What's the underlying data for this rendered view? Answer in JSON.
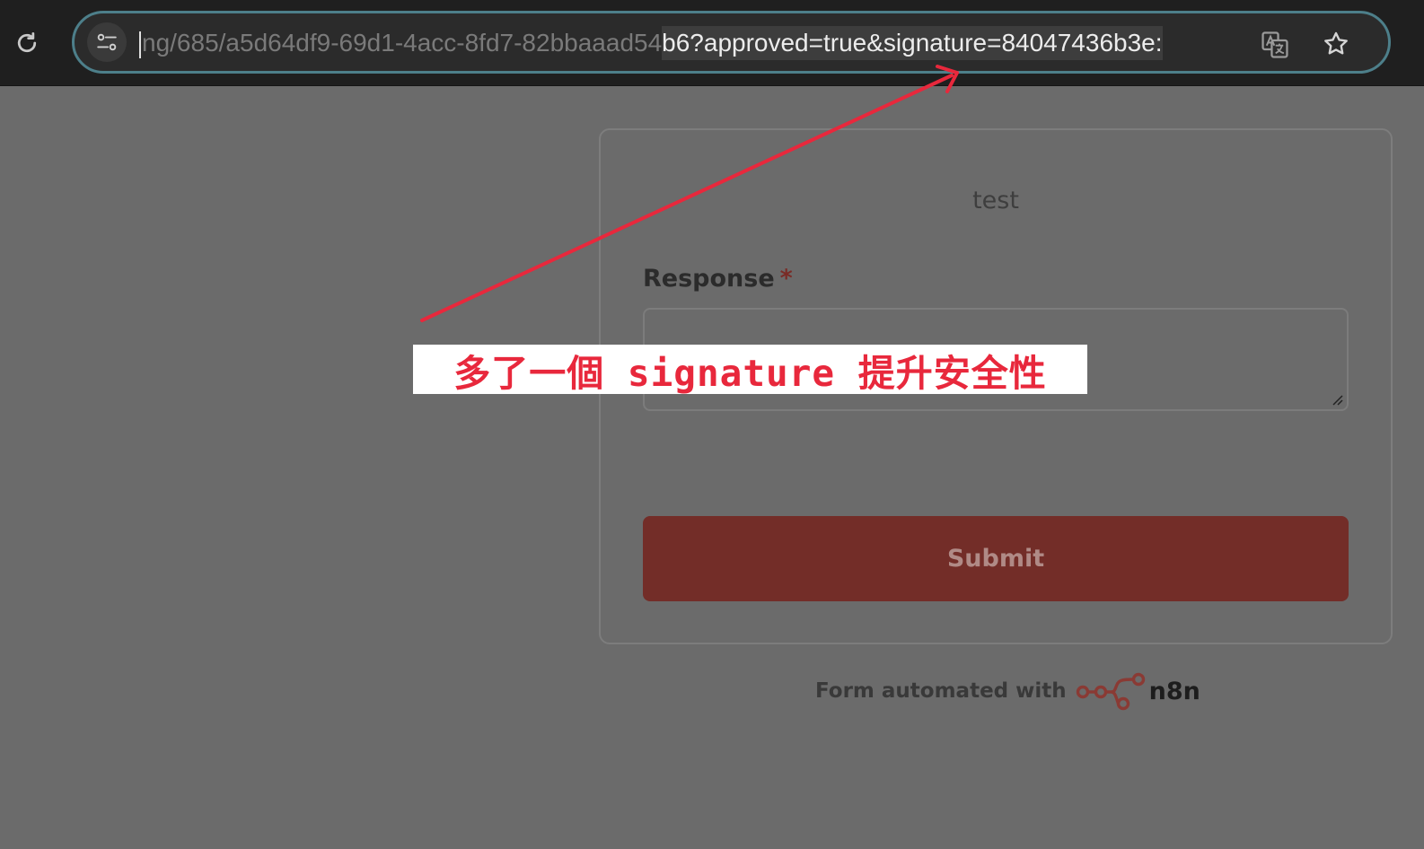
{
  "browser": {
    "url_hidden_prefix": "ng/685/a5d64df9-69d1-4acc-8fd7-82bbaaad54",
    "url_selected_part": "b6?approved=true&signature=84047436b3e:",
    "icons": {
      "reload": "reload-icon",
      "site_info": "tune-icon",
      "translate": "translate-icon",
      "bookmark": "star-icon"
    }
  },
  "form": {
    "title": "test",
    "field_label": "Response",
    "required_marker": "*",
    "response_value": "",
    "submit_label": "Submit"
  },
  "footer": {
    "text": "Form automated with",
    "brand": "n8n"
  },
  "annotation": {
    "text": "多了一個 signature 提升安全性",
    "color": "#e8283c"
  },
  "colors": {
    "overlay_bg": "#6b6b6b",
    "toolbar_bg": "#1f1f1f",
    "omnibox_border": "#4d7f8a",
    "submit_bg": "#732d28",
    "n8n_brand": "#8a3a34"
  }
}
